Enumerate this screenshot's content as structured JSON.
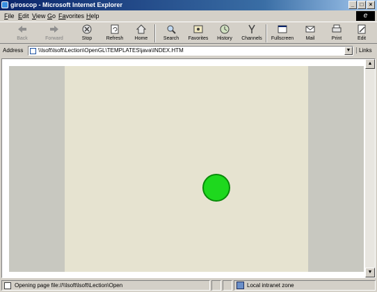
{
  "window": {
    "title": "giroscop - Microsoft Internet Explorer",
    "minimize_glyph": "_",
    "maximize_glyph": "□",
    "close_glyph": "×"
  },
  "menu": [
    {
      "first": "F",
      "rest": "ile"
    },
    {
      "first": "E",
      "rest": "dit"
    },
    {
      "first": "V",
      "rest": "iew"
    },
    {
      "first": "G",
      "rest": "o"
    },
    {
      "first": "Fa",
      "rest": "vorites"
    },
    {
      "first": "H",
      "rest": "elp"
    }
  ],
  "toolbar": {
    "back": "Back",
    "forward": "Forward",
    "stop": "Stop",
    "refresh": "Refresh",
    "home": "Home",
    "search": "Search",
    "favorites": "Favorites",
    "history": "History",
    "channels": "Channels",
    "fullscreen": "Fullscreen",
    "mail": "Mail",
    "print": "Print",
    "edit": "Edit"
  },
  "address": {
    "label": "Address",
    "value": "\\\\lsoft\\lsoft\\Lection\\OpenGL\\TEMPLATES\\java\\INDEX.HTM",
    "links_label": "Links"
  },
  "status": {
    "text": "Opening page file://\\\\lsoft\\lsoft\\Lection\\Open",
    "zone": "Local intranet zone"
  },
  "colors": {
    "ball": "#1ed81e",
    "page_background": "#e6e3d0",
    "side_panels": "#c8c8c0"
  }
}
